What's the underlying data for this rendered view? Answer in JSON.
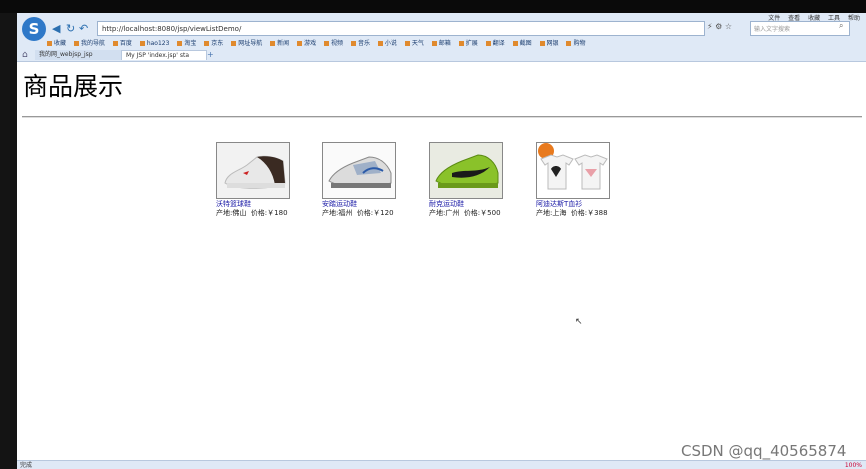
{
  "browser": {
    "address": "http://localhost:8080/jsp/viewListDemo/",
    "search_placeholder": "输入文字搜索",
    "menu": [
      "文件",
      "查看",
      "收藏",
      "工具",
      "帮助"
    ],
    "bookmarks": [
      "收藏",
      "我的导航",
      "百度",
      "hao123",
      "淘宝",
      "京东",
      "网址导航",
      "新闻",
      "游戏",
      "视频",
      "音乐",
      "小说",
      "天气",
      "邮箱",
      "扩展",
      "翻译",
      "截图",
      "网银",
      "购物"
    ],
    "tabs": [
      {
        "label": "我的网_webjsp_jsp"
      },
      {
        "label": "My JSP 'index.jsp' sta"
      }
    ]
  },
  "page": {
    "title": "商品展示"
  },
  "products": [
    {
      "name": "沃特篮球鞋",
      "origin": "产地:佛山",
      "price": "价格:￥180"
    },
    {
      "name": "安踏运动鞋",
      "origin": "产地:福州",
      "price": "价格:￥120"
    },
    {
      "name": "耐克运动鞋",
      "origin": "产地:广州",
      "price": "价格:￥500"
    },
    {
      "name": "阿迪达斯T血衫",
      "origin": "产地:上海",
      "price": "价格:￥388"
    }
  ],
  "status": {
    "left": "完成",
    "right": "100%"
  },
  "watermark": "CSDN @qq_40565874"
}
